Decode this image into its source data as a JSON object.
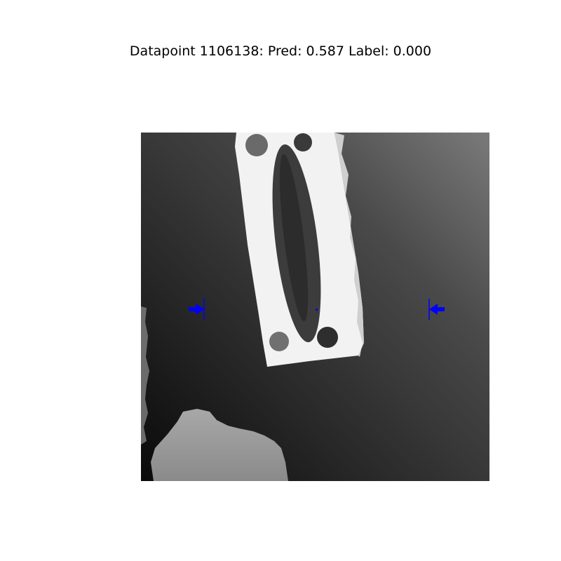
{
  "title": "Datapoint 1106138: Pred: 0.587 Label: 0.000",
  "datapoint_id": 1106138,
  "prediction": 0.587,
  "label": 0.0,
  "image": {
    "kind": "grayscale depth image",
    "content": "bright rectangular object with elongated oval slot on darker gradient background, gray blob bottom-left",
    "grasp_marker_color": "#0000ff"
  }
}
